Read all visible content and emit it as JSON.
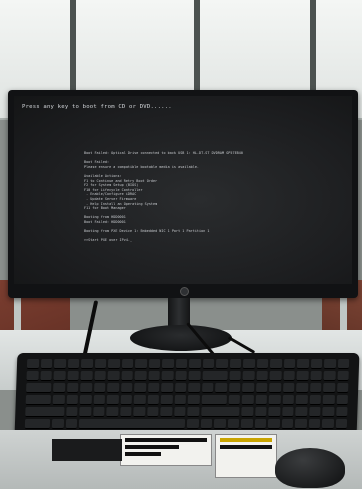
{
  "boot_screen": {
    "prompt": "Press any key to boot from CD or DVD......",
    "lines": [
      "Boot Failed: Optical Drive connected to back USB 1: HL-DT-ST DVDRAM GP57EB40",
      "",
      "Boot Failed:",
      "Please ensure a compatible bootable media is available.",
      "",
      "Available Actions:",
      "F1 to Continue and Retry Boot Order",
      "F2 for System Setup (BIOS)",
      "F10 for Lifecycle Controller",
      " - Enable/Configure iDRAC",
      " - Update Server Firmware",
      " - Help Install an Operating System",
      "F11 for Boot Manager",
      "",
      "Booting from HDD0001",
      "Boot Failed: HDD0001",
      "",
      "Booting from PXE Device 1: Embedded NIC 1 Port 1 Partition 1",
      "",
      ">>Start PXE over IPv4._"
    ]
  },
  "colors": {
    "screen_text": "#c9ccd0",
    "screen_bg": "#1b1c1e"
  }
}
